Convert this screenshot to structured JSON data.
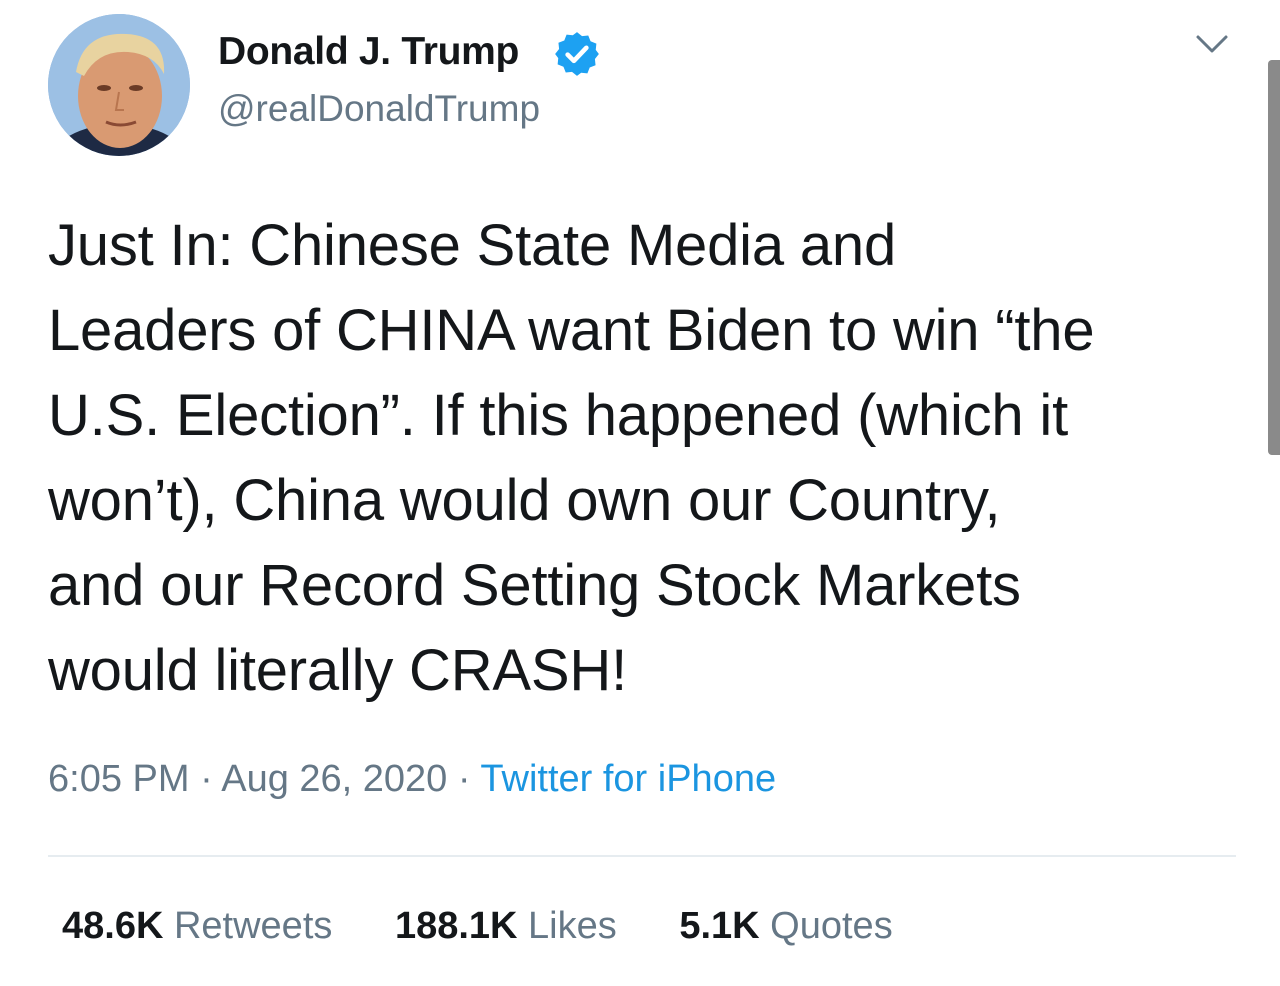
{
  "author": {
    "display_name": "Donald J. Trump",
    "handle": "@realDonaldTrump",
    "verified": true,
    "avatar_icon": "profile-photo"
  },
  "tweet": {
    "text": "Just In: Chinese State Media and\nLeaders of CHINA want Biden to win “the\nU.S. Election”.  If this happened (which it\nwon’t), China would own our Country,\nand our Record Setting Stock Markets\nwould literally CRASH!",
    "time": "6:05 PM",
    "date": "Aug 26, 2020",
    "separator": "·",
    "source": "Twitter for iPhone"
  },
  "stats": {
    "retweets_count": "48.6K",
    "retweets_label": "Retweets",
    "likes_count": "188.1K",
    "likes_label": "Likes",
    "quotes_count": "5.1K",
    "quotes_label": "Quotes"
  },
  "icons": {
    "verified": "verified-badge-icon",
    "menu": "chevron-down-icon"
  },
  "colors": {
    "link": "#1b95e0",
    "secondary_text": "#657786",
    "primary_text": "#14171a",
    "verified": "#1da1f2"
  }
}
